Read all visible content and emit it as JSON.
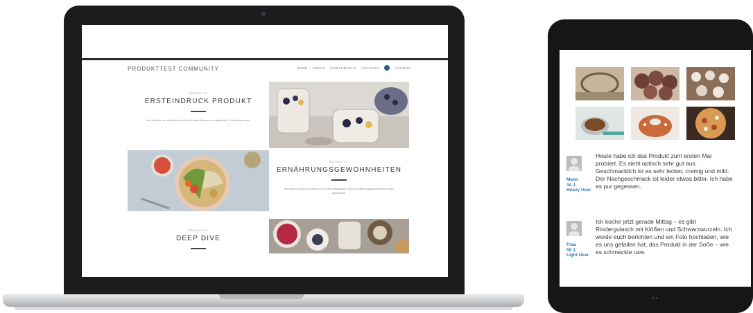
{
  "laptop_site": {
    "brand": "PRODUKTTEST COMMUNITY",
    "nav": [
      "HOME",
      "ABOUT",
      "SPIELREGELN",
      "ACCOUNT",
      "LOGOUT"
    ],
    "tiles": [
      {
        "meta": "BEITRAG 1/3",
        "heading": "ERSTEINDRUCK PRODUKT",
        "desc": "Hier möchten wir mit Ihnen über Ihren Ersten Eindruck zum gewählten Produkt sprechen."
      },
      {
        "meta": "BEITRAG 2/3",
        "heading": "ERNÄHRUNGSGEWOHNHEITEN",
        "desc": "Bei diesem Thema möchten wir mit Ihnen diskutieren, welche Ernährungsgewohnheiten Ihnen wichtig sind."
      },
      {
        "meta": "BEITRAG 3/3",
        "heading": "DEEP DIVE",
        "desc": ""
      }
    ]
  },
  "tablet": {
    "comments": [
      {
        "user_gender": "Mann",
        "user_age": "34 J.",
        "user_type": "Heavy User",
        "text": "Heute habe ich das Produkt zum ersten Mal probiert. Es sieht optisch sehr gut aus. Geschmacklich ist es sehr lecker, cremig und mild. Der Nachgeschmack ist leider etwas bitter. Ich habe es pur gegessen."
      },
      {
        "user_gender": "Frau",
        "user_age": "55 J.",
        "user_type": "Light User",
        "text": "Ich koche jetzt gerade Mittag – es gibt Rindergulasch mit Klößen und Schwarzwurzeln. Ich werde euch berichten und ein Foto hochladen, wie es uns gefallen hat, das Produkt in der Soße – wie es schmeckte usw."
      }
    ]
  },
  "colors": {
    "accent": "#2a78b8",
    "dark_rule": "#2a2a2a",
    "device_frame": "#1b1c1e"
  },
  "icons": [
    "user-icon",
    "avatar-placeholder-icon"
  ]
}
